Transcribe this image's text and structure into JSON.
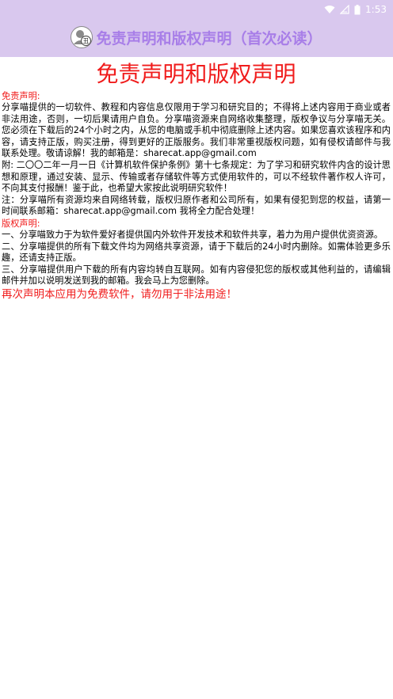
{
  "status_bar": {
    "time": "1:53",
    "icons": [
      "wifi-icon",
      "signal-icon",
      "battery-icon"
    ]
  },
  "app_bar": {
    "title": "免责声明和版权声明（首次必读）",
    "logo_icon": "share-cat-logo-icon",
    "background": "#d9c8ee",
    "title_color": "#a87ee8"
  },
  "document": {
    "main_title": "免责声明和版权声明",
    "disclaimer_label": "免责声明:",
    "disclaimer_body": "分享喵提供的一切软件、教程和内容信息仅限用于学习和研究目的；不得将上述内容用于商业或者非法用途，否则，一切后果请用户自负。分享喵资源来自网络收集整理，版权争议与分享喵无关。您必须在下载后的24个小时之内，从您的电脑或手机中彻底删除上述内容。如果您喜欢该程序和内容，请支持正版，购买注册，得到更好的正版服务。我们非常重视版权问题，如有侵权请邮件与我联系处理。敬请谅解！我的邮箱是：sharecat.app@gmail.com",
    "appendix": "附: 二〇〇二年一月一日《计算机软件保护条例》第十七条规定：为了学习和研究软件内含的设计思想和原理，通过安装、显示、传输或者存储软件等方式使用软件的，可以不经软件著作权人许可，不向其支付报酬！鉴于此，也希望大家按此说明研究软件！",
    "note": "注：分享喵所有资源均来自网络转载，版权归原作者和公司所有，如果有侵犯到您的权益，请第一时间联系邮箱：sharecat.app@gmail.com 我将全力配合处理！",
    "copyright_label": "版权声明:",
    "copyright_items": [
      "一、分享喵致力于为软件爱好者提供国内外软件开发技术和软件共享，着力为用户提供优资资源。",
      "二、分享喵提供的所有下载文件均为网络共享资源，请于下载后的24小时内删除。如需体验更多乐趣，还请支持正版。",
      "三、分享喵提供用户下载的所有内容均转自互联网。如有内容侵犯您的版权或其他利益的，请编辑邮件并加以说明发送到我的邮箱。我会马上为您删除。"
    ],
    "final_notice": "再次声明本应用为免费软件，请勿用于非法用途！",
    "accent_color": "#f01c1c"
  }
}
